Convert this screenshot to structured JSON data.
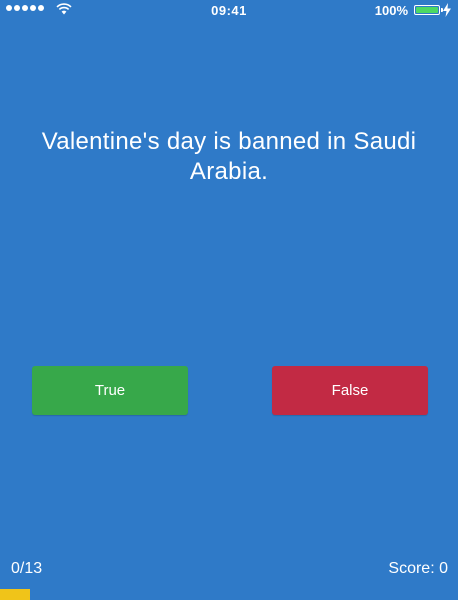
{
  "status_bar": {
    "time": "09:41",
    "battery_percent": "100%",
    "signal_bars": 5,
    "battery_level": 1.0,
    "battery_color": "#4cd964",
    "icons": [
      "signal-icon",
      "wifi-icon",
      "battery-icon",
      "charging-bolt-icon"
    ]
  },
  "quiz": {
    "question": "Valentine's day is banned in Saudi Arabia.",
    "true_label": "True",
    "false_label": "False",
    "progress_label": "0/13",
    "score_label": "Score: 0",
    "progress_fraction": 0.066
  },
  "colors": {
    "background": "#2f7ac8",
    "true_button": "#37a84a",
    "false_button": "#c22a44",
    "progress_bar": "#f0c419"
  }
}
